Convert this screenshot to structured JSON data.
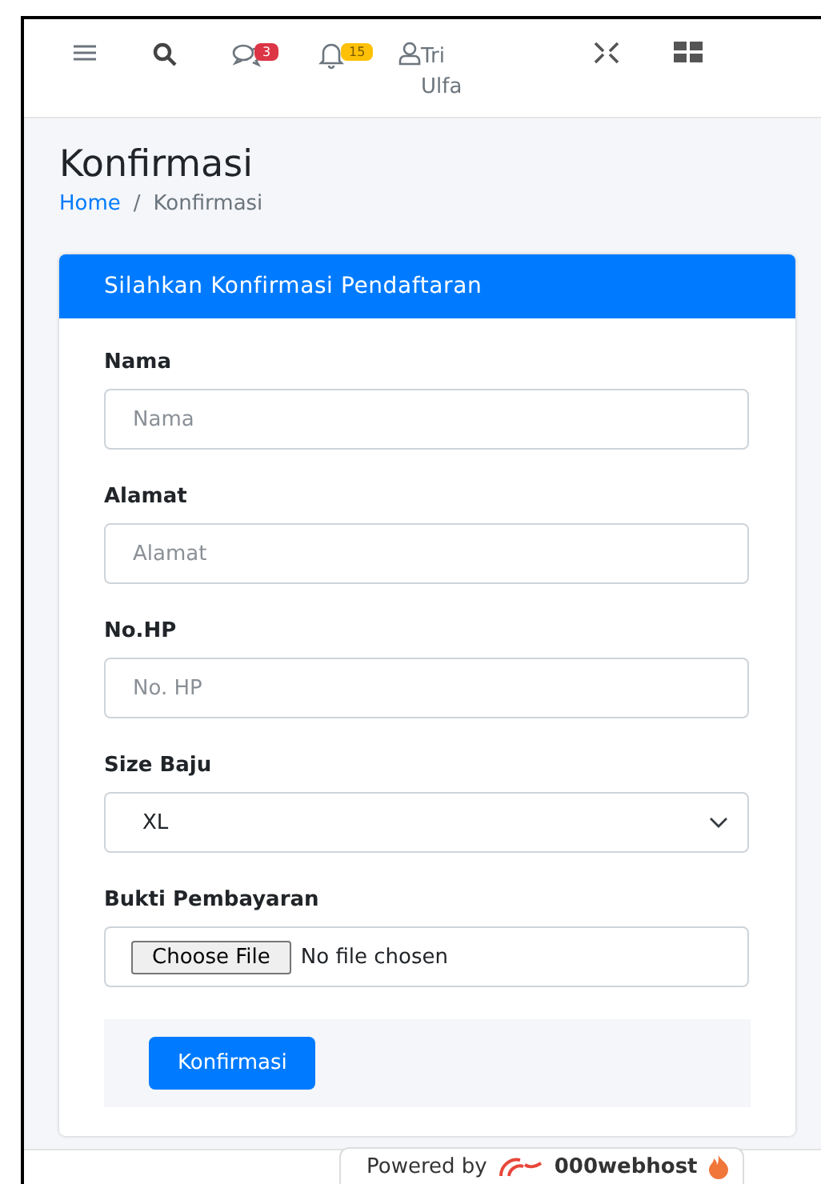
{
  "navbar": {
    "items": [
      {
        "kind": "menu"
      },
      {
        "kind": "search"
      },
      {
        "kind": "messages",
        "badge": "3",
        "color": "#dc3545"
      },
      {
        "kind": "notifications",
        "badge": "15",
        "color": "#ffc107"
      },
      {
        "kind": "user",
        "label": "Tri Ulfa"
      },
      {
        "kind": "fullscreen"
      },
      {
        "kind": "apps"
      }
    ]
  },
  "page": {
    "title": "Konfirmasi",
    "breadcrumb_separator": "/",
    "breadcrumb": [
      {
        "label": "Home",
        "link": true
      },
      {
        "label": "Konfirmasi",
        "link": false
      }
    ]
  },
  "card": {
    "header": "Silahkan Konfirmasi Pendaftaran",
    "fields": [
      {
        "kind": "text",
        "label": "Nama",
        "placeholder": "Nama"
      },
      {
        "kind": "text",
        "label": "Alamat",
        "placeholder": "Alamat"
      },
      {
        "kind": "text",
        "label": "No.HP",
        "placeholder": "No. HP"
      },
      {
        "kind": "select",
        "label": "Size Baju",
        "value": "XL"
      },
      {
        "kind": "file",
        "label": "Bukti Pembayaran",
        "button": "Choose File",
        "status": "No file chosen"
      }
    ],
    "submit": "Konfirmasi"
  },
  "powered_badge": {
    "prefix": "Powered by",
    "brand": "000webhost"
  }
}
